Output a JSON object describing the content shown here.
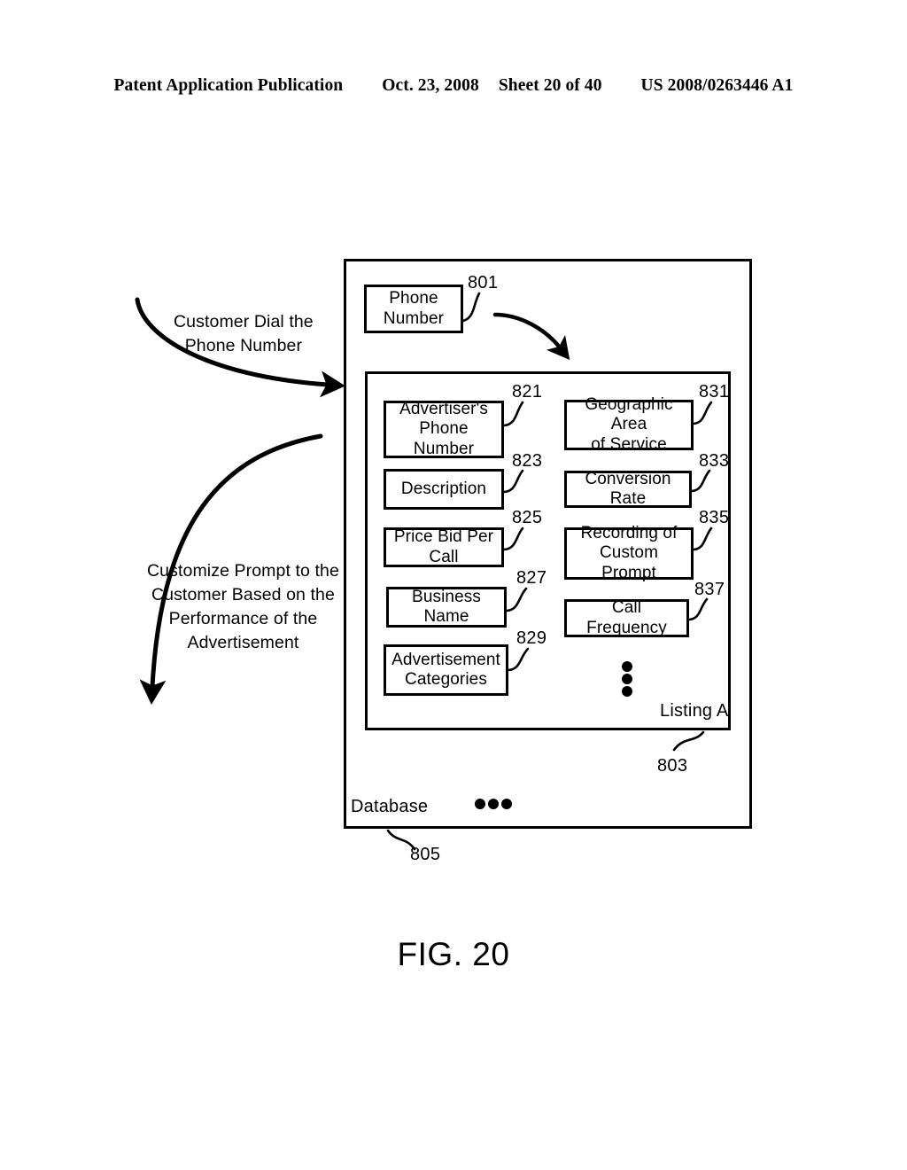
{
  "header": {
    "publication": "Patent Application Publication",
    "date": "Oct. 23, 2008",
    "sheet": "Sheet 20 of 40",
    "patent_number": "US 2008/0263446 A1"
  },
  "figure": {
    "caption": "FIG. 20"
  },
  "annotations": [
    {
      "id": "customer-dial",
      "line1": "Customer Dial the",
      "line2": "Phone Number"
    },
    {
      "id": "customize-prompt",
      "line1": "Customize Prompt to the",
      "line2": "Customer Based on the",
      "line3": "Performance of the",
      "line4": "Advertisement"
    }
  ],
  "diagram": {
    "database_label": "Database",
    "database_ref": "805",
    "listing_label": "Listing A",
    "listing_ref": "803",
    "phone_number": {
      "line1": "Phone",
      "line2": "Number",
      "ref": "801"
    },
    "left_column": [
      {
        "line1": "Advertiser's",
        "line2": "Phone Number",
        "ref": "821"
      },
      {
        "line1": "Description",
        "line2": "",
        "ref": "823"
      },
      {
        "line1": "Price Bid Per Call",
        "line2": "",
        "ref": "825"
      },
      {
        "line1": "Business Name",
        "line2": "",
        "ref": "827"
      },
      {
        "line1": "Advertisement",
        "line2": "Categories",
        "ref": "829"
      }
    ],
    "right_column": [
      {
        "line1": "Geographic Area",
        "line2": "of Service",
        "ref": "831"
      },
      {
        "line1": "Conversion Rate",
        "line2": "",
        "ref": "833"
      },
      {
        "line1": "Recording of",
        "line2": "Custom Prompt",
        "ref": "835"
      },
      {
        "line1": "Call Frequency",
        "line2": "",
        "ref": "837"
      }
    ]
  },
  "colors": {
    "ink": "#000000",
    "paper": "#ffffff"
  }
}
